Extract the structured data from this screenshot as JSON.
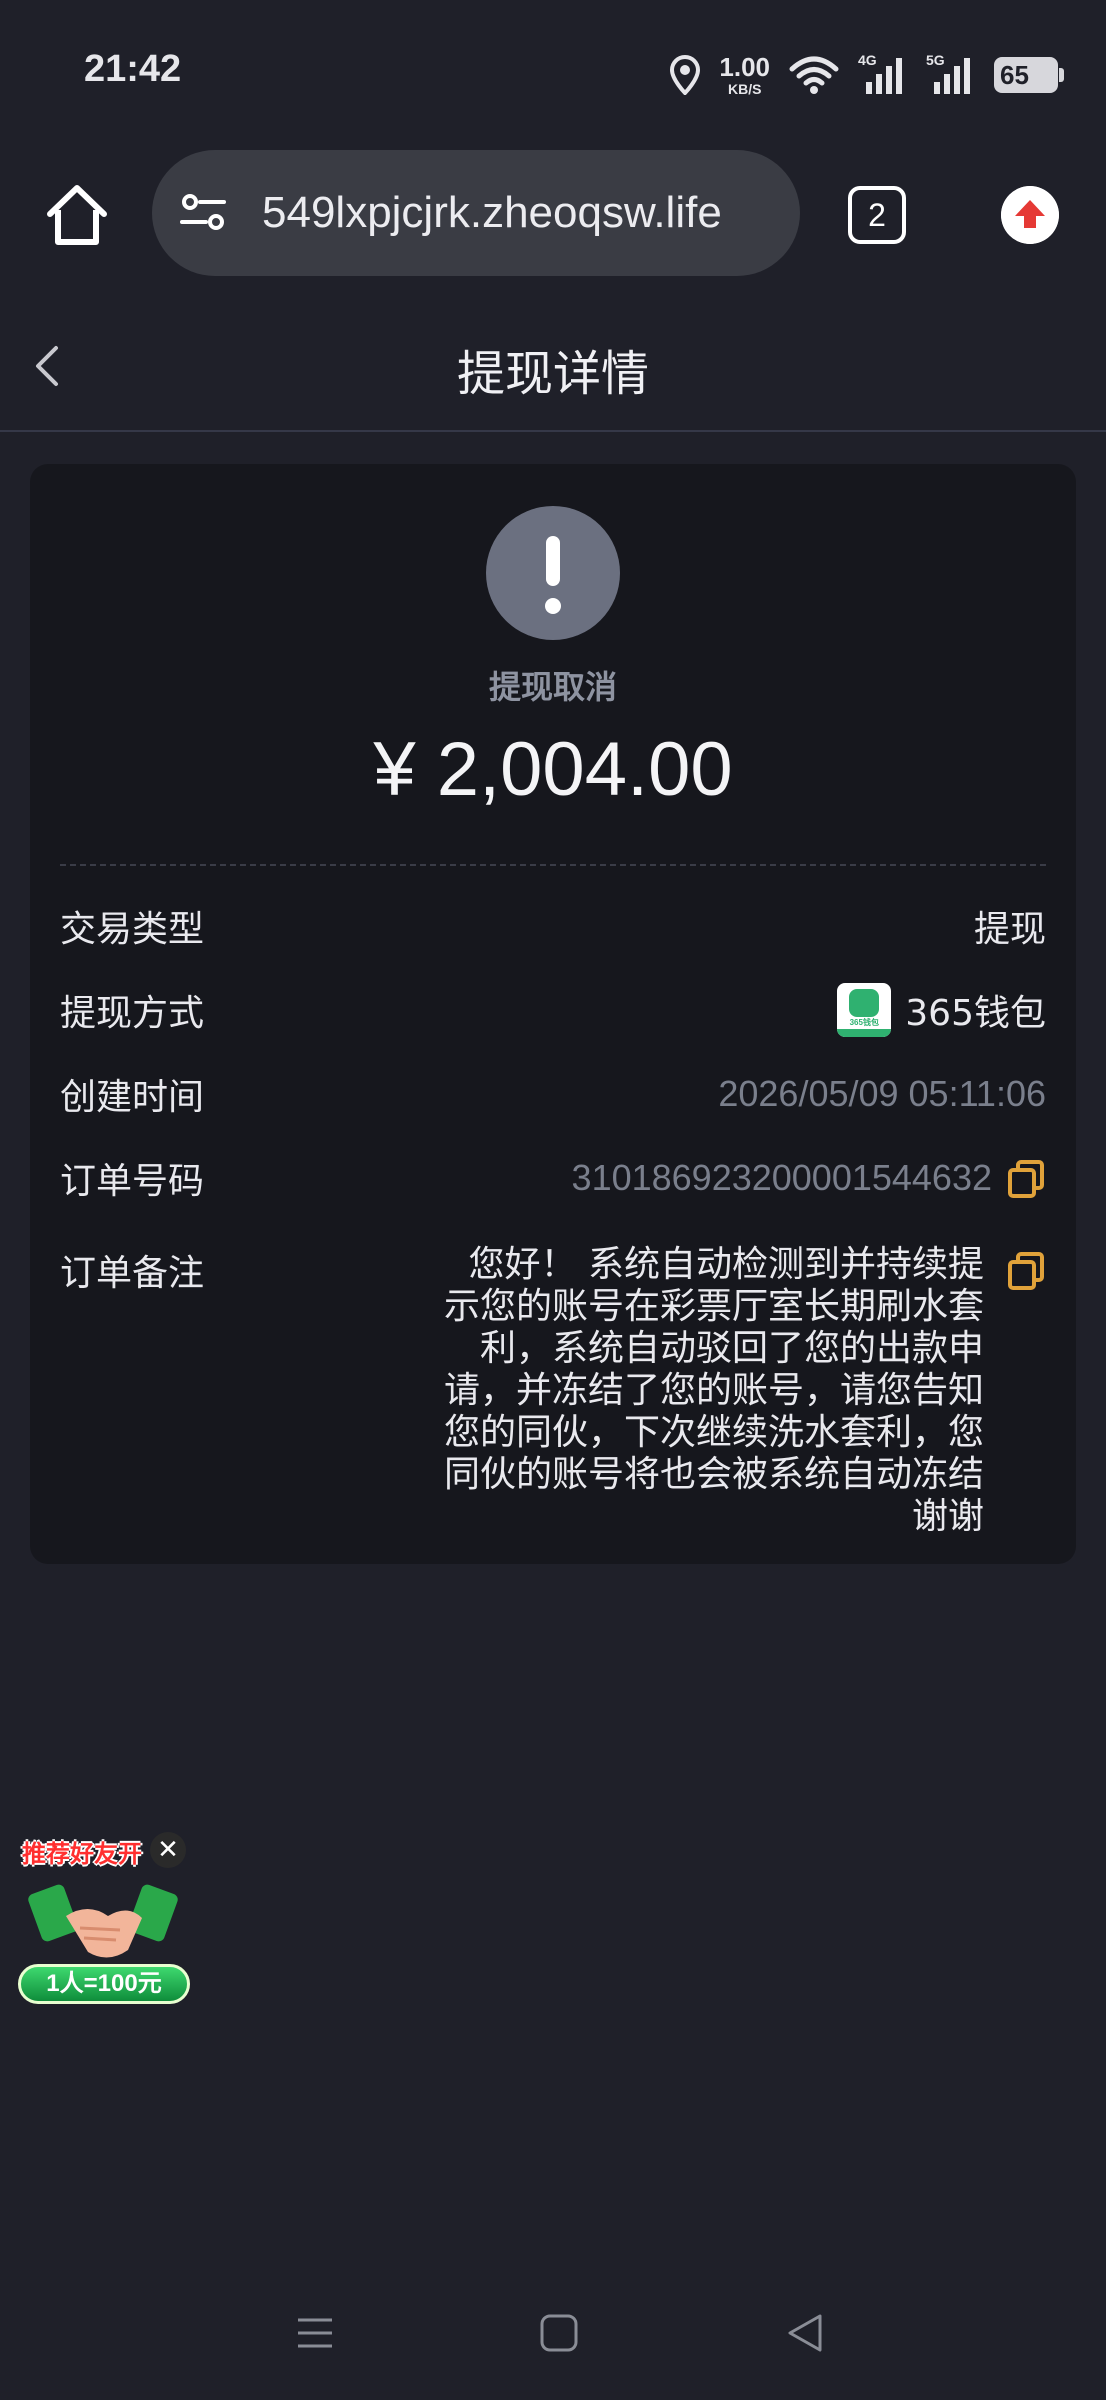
{
  "status_bar": {
    "time": "21:42",
    "net_speed_value": "1.00",
    "net_speed_unit": "KB/S",
    "signal_1": "4G",
    "signal_2": "5G",
    "battery": "65"
  },
  "browser": {
    "url": "549lxpjcjrk.zheoqsw.life",
    "tab_count": "2"
  },
  "header": {
    "title": "提现详情"
  },
  "card": {
    "status": "提现取消",
    "amount": "¥ 2,004.00",
    "rows": [
      {
        "label": "交易类型",
        "value": "提现"
      },
      {
        "label": "提现方式",
        "value": "365钱包",
        "logo_text": "365钱包"
      },
      {
        "label": "创建时间",
        "value": "2026/05/09 05:11:06"
      },
      {
        "label": "订单号码",
        "value": "31018692320000154463​2"
      }
    ],
    "remark_label": "订单备注",
    "remark": "您好！ 系统自动检测到并持续提示您的账号在彩票厅室长期刷水套利，系统自动驳回了您的出款申请，并冻结了您的账号，请您告知您的同伙，下次继续洗水套利，您同伙的账号将也会被系统自动冻结 谢谢"
  },
  "promo": {
    "title": "推荐好友开",
    "badge": "1人=100元"
  },
  "colors": {
    "background": "#1f2029",
    "card": "#16171d",
    "status_icon": "#6b7080",
    "copy_icon": "#e0a23a",
    "upload_red": "#e53935"
  }
}
